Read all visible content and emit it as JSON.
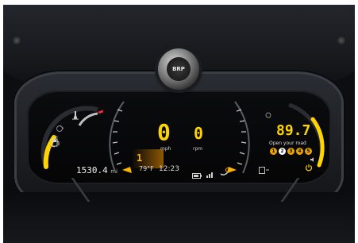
{
  "speed": {
    "value": "0",
    "unit": "mph"
  },
  "rpm": {
    "value": "0",
    "unit": "rpm"
  },
  "gear": "1",
  "odometer": {
    "value": "1530.4",
    "unit": "mi"
  },
  "temperature": "79°F",
  "clock": "12:23",
  "radio": {
    "frequency": "89.7",
    "message": "Open your road"
  },
  "presets": [
    "1",
    "2",
    "3",
    "4",
    "5"
  ],
  "knob_logo": "BRP",
  "colors": {
    "accent": "#ffd400",
    "amber": "#ffb400",
    "text": "#dcdcdc",
    "screen": "#050506"
  },
  "icons": [
    "engine-warning-icon",
    "coolant-temp-icon",
    "fuel-icon",
    "battery-icon",
    "signal-icon",
    "phone-icon",
    "media-icon",
    "power-icon",
    "volume-icon"
  ]
}
